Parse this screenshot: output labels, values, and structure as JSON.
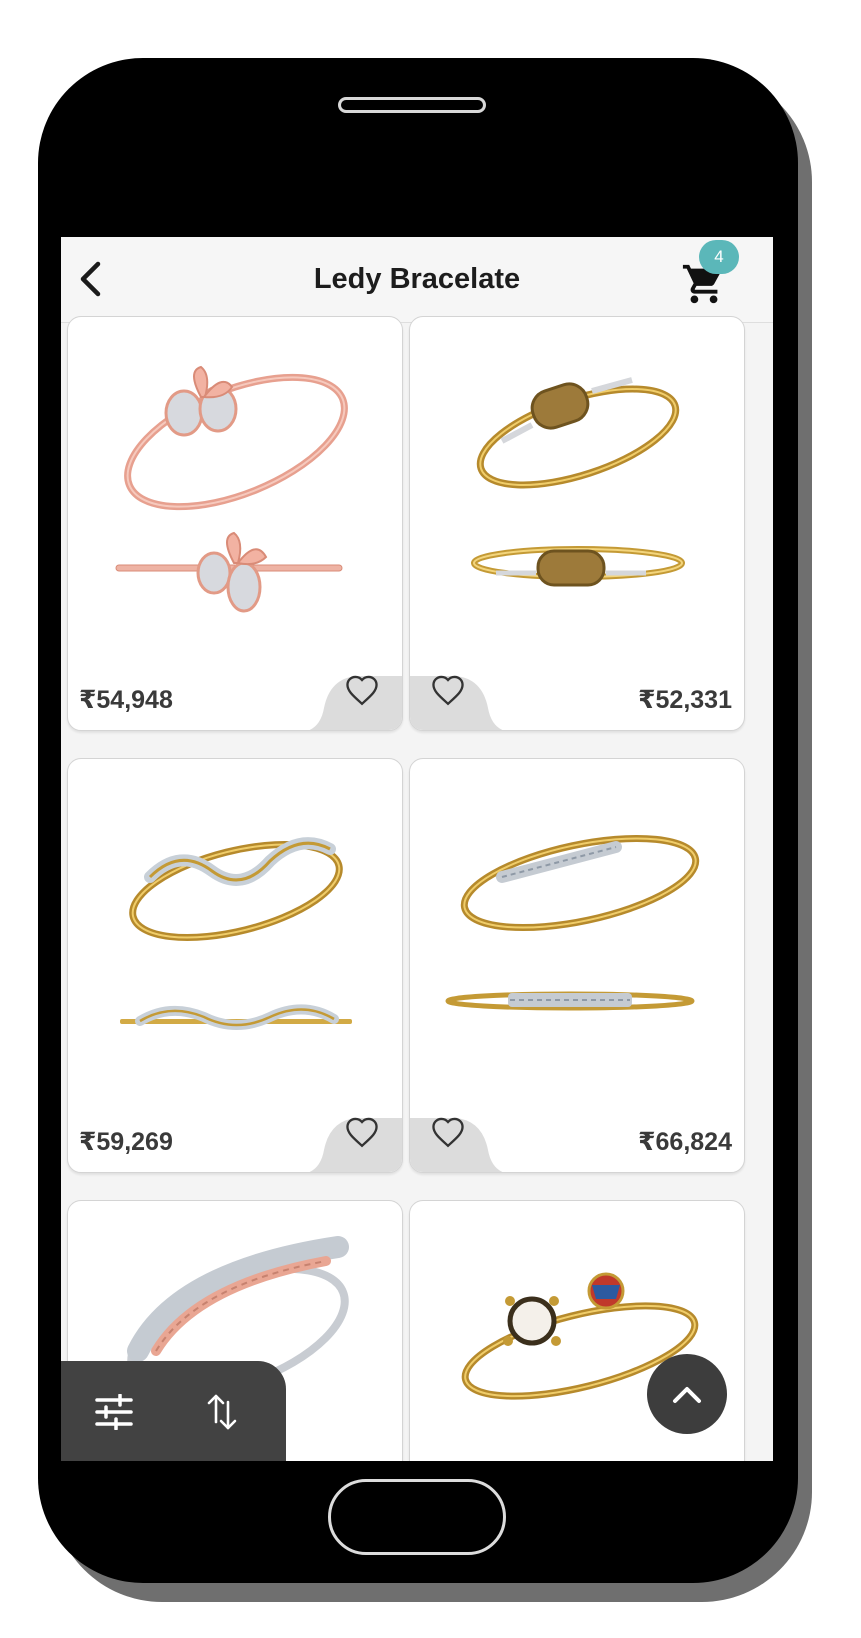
{
  "header": {
    "title": "Ledy Bracelate",
    "back_icon": "chevron-left-icon",
    "cart_icon": "shopping-cart-icon",
    "cart_count": "4"
  },
  "colors": {
    "accent_badge": "#5bb7b9",
    "toolbar": "#424242",
    "price_text": "#3a3a3a"
  },
  "products": [
    {
      "price": "₹54,948",
      "metal": "rose-gold",
      "wishlisted": false
    },
    {
      "price": "₹52,331",
      "metal": "yellow-gold",
      "wishlisted": false
    },
    {
      "price": "₹59,269",
      "metal": "yellow-gold",
      "wishlisted": false
    },
    {
      "price": "₹66,824",
      "metal": "yellow-gold",
      "wishlisted": false
    },
    {
      "metal": "white-rose-gold"
    },
    {
      "metal": "yellow-gold"
    }
  ],
  "toolbar": {
    "filter_icon": "sliders-icon",
    "sort_icon": "sort-arrows-icon"
  },
  "scroll_top_icon": "chevron-up-icon"
}
